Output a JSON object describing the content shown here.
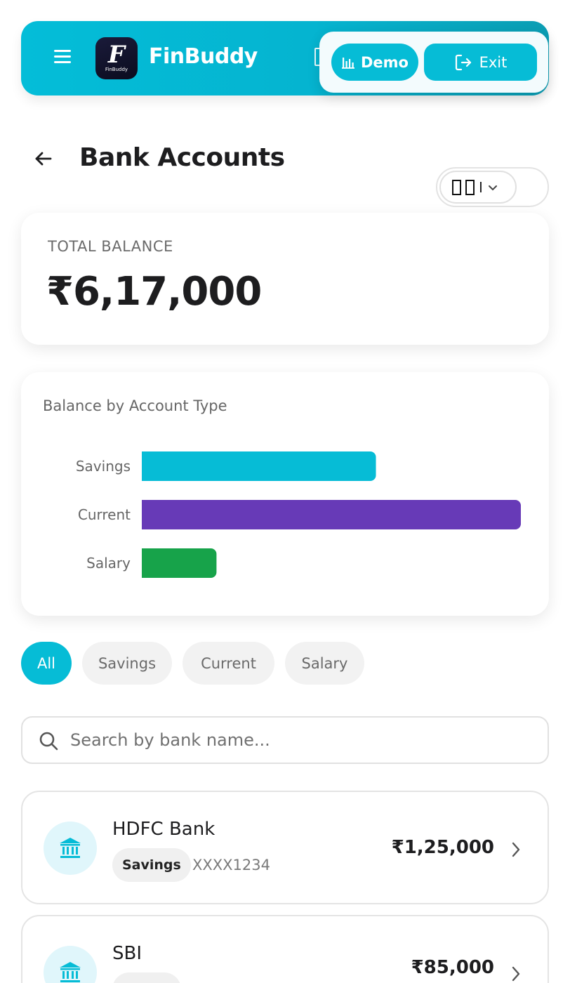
{
  "header": {
    "brand": "FinBuddy",
    "logo_text": "FinBuddy",
    "demo_label": "Demo",
    "exit_label": "Exit",
    "accent": "#06bcd6"
  },
  "page": {
    "title": "Bank Accounts",
    "language_selector": "I"
  },
  "total": {
    "label": "TOTAL BALANCE",
    "value": "₹6,17,000"
  },
  "chart_data": {
    "type": "bar",
    "orientation": "horizontal",
    "title": "Balance by Account Type",
    "categories": [
      "Savings",
      "Current",
      "Salary"
    ],
    "values": [
      210000,
      340000,
      67000
    ],
    "colors": [
      "#06bcd6",
      "#673ab7",
      "#17a34a"
    ],
    "xlim": [
      0,
      340000
    ],
    "grid": false,
    "legend": "none"
  },
  "filters": [
    {
      "label": "All",
      "active": true
    },
    {
      "label": "Savings",
      "active": false
    },
    {
      "label": "Current",
      "active": false
    },
    {
      "label": "Salary",
      "active": false
    }
  ],
  "search": {
    "placeholder": "Search by bank name..."
  },
  "accounts": [
    {
      "name": "HDFC Bank",
      "type": "Savings",
      "number": "XXXX1234",
      "balance": "₹1,25,000"
    },
    {
      "name": "SBI",
      "type": "",
      "number": "",
      "balance": "₹85,000"
    }
  ]
}
